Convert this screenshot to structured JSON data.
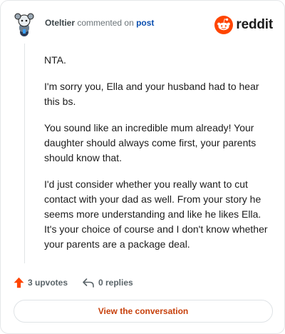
{
  "comment": {
    "username": "Oteltier",
    "action_text": "commented on",
    "target_link": "post",
    "avatar_icon": "snoo-avatar-icon",
    "paragraphs": [
      "NTA.",
      "I'm sorry you, Ella and your husband had to hear this bs.",
      "You sound like an incredible mum already! Your daughter should always come first, your parents should know that.",
      "I'd just consider whether you really want to cut contact with your dad as well. From your story he seems more understanding and like he likes Ella. It's your choice of course and I don't know whether your parents are a package deal."
    ]
  },
  "brand": {
    "wordmark": "reddit",
    "icon": "reddit-snoo-icon",
    "color": "#ff4500"
  },
  "actions": {
    "upvotes": "3 upvotes",
    "upvote_icon": "upvote-arrow-icon",
    "upvote_color": "#ff4500",
    "replies": "0 replies",
    "reply_icon": "reply-arrow-icon"
  },
  "footer": {
    "view_conversation": "View the conversation"
  },
  "colors": {
    "link": "#0a4fb0",
    "cta": "#c7400b"
  }
}
